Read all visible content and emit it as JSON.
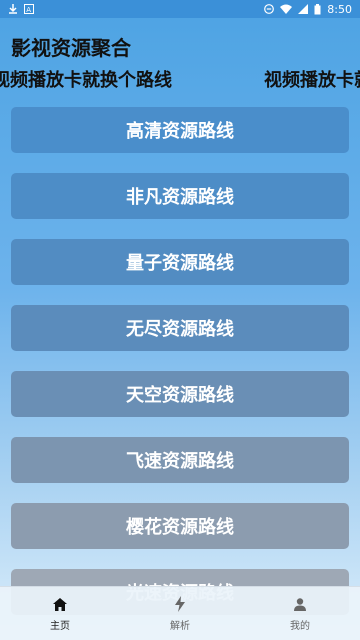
{
  "status_bar": {
    "time": "8:50",
    "left_icons": [
      "download-icon",
      "notification-app-icon"
    ],
    "right_icons": [
      "minus-circle-icon",
      "wifi-icon",
      "signal-icon",
      "battery-icon"
    ]
  },
  "app": {
    "title": "影视资源聚合"
  },
  "marquee": {
    "text": "视频播放卡就换个路线"
  },
  "routes": [
    {
      "label": "高清资源路线",
      "color": "#4a8ecb"
    },
    {
      "label": "非凡资源路线",
      "color": "#4d8dc7"
    },
    {
      "label": "量子资源路线",
      "color": "#528cc2"
    },
    {
      "label": "无尽资源路线",
      "color": "#5b8cbc"
    },
    {
      "label": "天空资源路线",
      "color": "#6a8fb5"
    },
    {
      "label": "飞速资源路线",
      "color": "#7c95b0"
    },
    {
      "label": "樱花资源路线",
      "color": "#8c9caf"
    },
    {
      "label": "光速资源路线",
      "color": "#9ea8b5"
    }
  ],
  "bottom_nav": [
    {
      "label": "主页",
      "icon": "home-icon",
      "active": true
    },
    {
      "label": "解析",
      "icon": "lightning-icon",
      "active": false
    },
    {
      "label": "我的",
      "icon": "person-icon",
      "active": false
    }
  ],
  "colors": {
    "status_bar": "#3b90d8",
    "text_primary": "#111111"
  }
}
